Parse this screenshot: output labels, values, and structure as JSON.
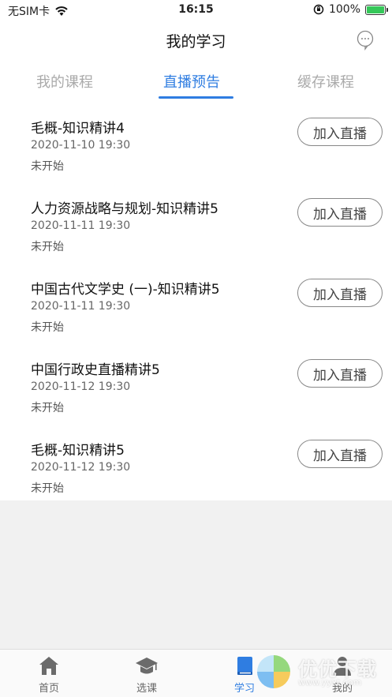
{
  "status_bar": {
    "carrier": "无SIM卡",
    "time": "16:15",
    "battery": "100%"
  },
  "header": {
    "title": "我的学习"
  },
  "tabs": [
    {
      "label": "我的课程",
      "active": false
    },
    {
      "label": "直播预告",
      "active": true
    },
    {
      "label": "缓存课程",
      "active": false
    }
  ],
  "live_list": [
    {
      "title": "毛概-知识精讲4",
      "datetime": "2020-11-10 19:30",
      "status": "未开始",
      "button": "加入直播"
    },
    {
      "title": "人力资源战略与规划-知识精讲5",
      "datetime": "2020-11-11 19:30",
      "status": "未开始",
      "button": "加入直播"
    },
    {
      "title": "中国古代文学史 (一)-知识精讲5",
      "datetime": "2020-11-11 19:30",
      "status": "未开始",
      "button": "加入直播"
    },
    {
      "title": "中国行政史直播精讲5",
      "datetime": "2020-11-12 19:30",
      "status": "未开始",
      "button": "加入直播"
    },
    {
      "title": "毛概-知识精讲5",
      "datetime": "2020-11-12 19:30",
      "status": "未开始",
      "button": "加入直播"
    }
  ],
  "tab_bar": [
    {
      "label": "首页",
      "icon": "home-icon",
      "active": false
    },
    {
      "label": "选课",
      "icon": "graduation-cap-icon",
      "active": false
    },
    {
      "label": "学习",
      "icon": "book-icon",
      "active": true
    },
    {
      "label": "我的",
      "icon": "user-icon",
      "active": false
    }
  ],
  "watermark": {
    "text": "优优下载",
    "sub": "www.yyxt.com"
  },
  "colors": {
    "accent": "#2f7de1",
    "inactive_tab": "#aaaaaa",
    "background": "#f1f1f1"
  }
}
